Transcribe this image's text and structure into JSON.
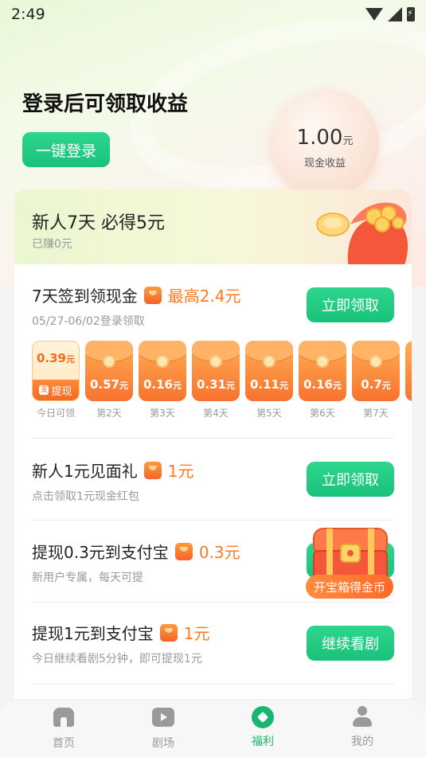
{
  "status_bar": {
    "time": "2:49"
  },
  "hero": {
    "title": "登录后可领取收益",
    "login_button": "一键登录",
    "earnings_amount": "1.00",
    "earnings_unit": "元",
    "earnings_label": "现金收益"
  },
  "newbie": {
    "title": "新人7天 必得5元",
    "subtitle": "已赚0元"
  },
  "signin_task": {
    "title": "7天签到领现金",
    "reward": "最高2.4元",
    "subtitle": "05/27-06/02登录领取",
    "button": "立即领取",
    "days": [
      {
        "amount": "0.39",
        "unit": "元",
        "tag": "提现",
        "label": "今日可领"
      },
      {
        "amount": "0.57",
        "unit": "元",
        "label": "第2天"
      },
      {
        "amount": "0.16",
        "unit": "元",
        "label": "第3天"
      },
      {
        "amount": "0.31",
        "unit": "元",
        "label": "第4天"
      },
      {
        "amount": "0.11",
        "unit": "元",
        "label": "第5天"
      },
      {
        "amount": "0.16",
        "unit": "元",
        "label": "第6天"
      },
      {
        "amount": "0.7",
        "unit": "元",
        "label": "第7天"
      }
    ]
  },
  "tasks": [
    {
      "title": "新人1元见面礼",
      "reward": "1元",
      "subtitle": "点击领取1元现金红包",
      "button": "立即领取"
    },
    {
      "title": "提现0.3元到支付宝",
      "reward": "0.3元",
      "subtitle": "新用户专属，每天可提",
      "button": ""
    },
    {
      "title": "提现1元到支付宝",
      "reward": "1元",
      "subtitle": "今日继续看剧5分钟，即可提现1元",
      "button": "继续看剧"
    }
  ],
  "treasure_chest": {
    "label": "开宝箱得金币"
  },
  "bottom_nav": [
    {
      "label": "首页",
      "icon": "home-icon",
      "active": false
    },
    {
      "label": "剧场",
      "icon": "play-icon",
      "active": false
    },
    {
      "label": "福利",
      "icon": "welfare-icon",
      "active": true
    },
    {
      "label": "我的",
      "icon": "user-icon",
      "active": false
    }
  ],
  "colors": {
    "primary_green": "#19c27a",
    "reward_orange": "#ff7a1e",
    "active_nav": "#15b86e"
  }
}
